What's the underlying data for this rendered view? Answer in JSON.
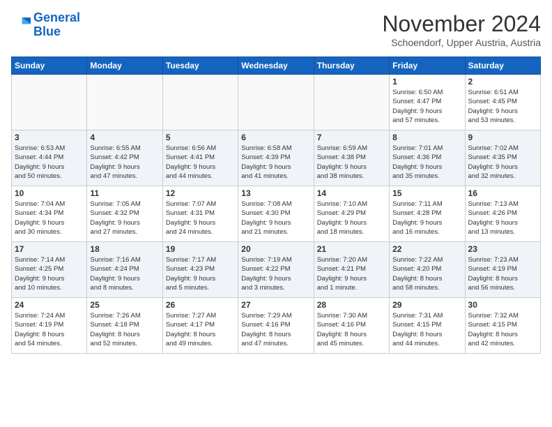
{
  "header": {
    "logo_line1": "General",
    "logo_line2": "Blue",
    "month": "November 2024",
    "location": "Schoendorf, Upper Austria, Austria"
  },
  "weekdays": [
    "Sunday",
    "Monday",
    "Tuesday",
    "Wednesday",
    "Thursday",
    "Friday",
    "Saturday"
  ],
  "weeks": [
    [
      {
        "day": "",
        "info": ""
      },
      {
        "day": "",
        "info": ""
      },
      {
        "day": "",
        "info": ""
      },
      {
        "day": "",
        "info": ""
      },
      {
        "day": "",
        "info": ""
      },
      {
        "day": "1",
        "info": "Sunrise: 6:50 AM\nSunset: 4:47 PM\nDaylight: 9 hours\nand 57 minutes."
      },
      {
        "day": "2",
        "info": "Sunrise: 6:51 AM\nSunset: 4:45 PM\nDaylight: 9 hours\nand 53 minutes."
      }
    ],
    [
      {
        "day": "3",
        "info": "Sunrise: 6:53 AM\nSunset: 4:44 PM\nDaylight: 9 hours\nand 50 minutes."
      },
      {
        "day": "4",
        "info": "Sunrise: 6:55 AM\nSunset: 4:42 PM\nDaylight: 9 hours\nand 47 minutes."
      },
      {
        "day": "5",
        "info": "Sunrise: 6:56 AM\nSunset: 4:41 PM\nDaylight: 9 hours\nand 44 minutes."
      },
      {
        "day": "6",
        "info": "Sunrise: 6:58 AM\nSunset: 4:39 PM\nDaylight: 9 hours\nand 41 minutes."
      },
      {
        "day": "7",
        "info": "Sunrise: 6:59 AM\nSunset: 4:38 PM\nDaylight: 9 hours\nand 38 minutes."
      },
      {
        "day": "8",
        "info": "Sunrise: 7:01 AM\nSunset: 4:36 PM\nDaylight: 9 hours\nand 35 minutes."
      },
      {
        "day": "9",
        "info": "Sunrise: 7:02 AM\nSunset: 4:35 PM\nDaylight: 9 hours\nand 32 minutes."
      }
    ],
    [
      {
        "day": "10",
        "info": "Sunrise: 7:04 AM\nSunset: 4:34 PM\nDaylight: 9 hours\nand 30 minutes."
      },
      {
        "day": "11",
        "info": "Sunrise: 7:05 AM\nSunset: 4:32 PM\nDaylight: 9 hours\nand 27 minutes."
      },
      {
        "day": "12",
        "info": "Sunrise: 7:07 AM\nSunset: 4:31 PM\nDaylight: 9 hours\nand 24 minutes."
      },
      {
        "day": "13",
        "info": "Sunrise: 7:08 AM\nSunset: 4:30 PM\nDaylight: 9 hours\nand 21 minutes."
      },
      {
        "day": "14",
        "info": "Sunrise: 7:10 AM\nSunset: 4:29 PM\nDaylight: 9 hours\nand 18 minutes."
      },
      {
        "day": "15",
        "info": "Sunrise: 7:11 AM\nSunset: 4:28 PM\nDaylight: 9 hours\nand 16 minutes."
      },
      {
        "day": "16",
        "info": "Sunrise: 7:13 AM\nSunset: 4:26 PM\nDaylight: 9 hours\nand 13 minutes."
      }
    ],
    [
      {
        "day": "17",
        "info": "Sunrise: 7:14 AM\nSunset: 4:25 PM\nDaylight: 9 hours\nand 10 minutes."
      },
      {
        "day": "18",
        "info": "Sunrise: 7:16 AM\nSunset: 4:24 PM\nDaylight: 9 hours\nand 8 minutes."
      },
      {
        "day": "19",
        "info": "Sunrise: 7:17 AM\nSunset: 4:23 PM\nDaylight: 9 hours\nand 5 minutes."
      },
      {
        "day": "20",
        "info": "Sunrise: 7:19 AM\nSunset: 4:22 PM\nDaylight: 9 hours\nand 3 minutes."
      },
      {
        "day": "21",
        "info": "Sunrise: 7:20 AM\nSunset: 4:21 PM\nDaylight: 9 hours\nand 1 minute."
      },
      {
        "day": "22",
        "info": "Sunrise: 7:22 AM\nSunset: 4:20 PM\nDaylight: 8 hours\nand 58 minutes."
      },
      {
        "day": "23",
        "info": "Sunrise: 7:23 AM\nSunset: 4:19 PM\nDaylight: 8 hours\nand 56 minutes."
      }
    ],
    [
      {
        "day": "24",
        "info": "Sunrise: 7:24 AM\nSunset: 4:19 PM\nDaylight: 8 hours\nand 54 minutes."
      },
      {
        "day": "25",
        "info": "Sunrise: 7:26 AM\nSunset: 4:18 PM\nDaylight: 8 hours\nand 52 minutes."
      },
      {
        "day": "26",
        "info": "Sunrise: 7:27 AM\nSunset: 4:17 PM\nDaylight: 8 hours\nand 49 minutes."
      },
      {
        "day": "27",
        "info": "Sunrise: 7:29 AM\nSunset: 4:16 PM\nDaylight: 8 hours\nand 47 minutes."
      },
      {
        "day": "28",
        "info": "Sunrise: 7:30 AM\nSunset: 4:16 PM\nDaylight: 8 hours\nand 45 minutes."
      },
      {
        "day": "29",
        "info": "Sunrise: 7:31 AM\nSunset: 4:15 PM\nDaylight: 8 hours\nand 44 minutes."
      },
      {
        "day": "30",
        "info": "Sunrise: 7:32 AM\nSunset: 4:15 PM\nDaylight: 8 hours\nand 42 minutes."
      }
    ]
  ]
}
